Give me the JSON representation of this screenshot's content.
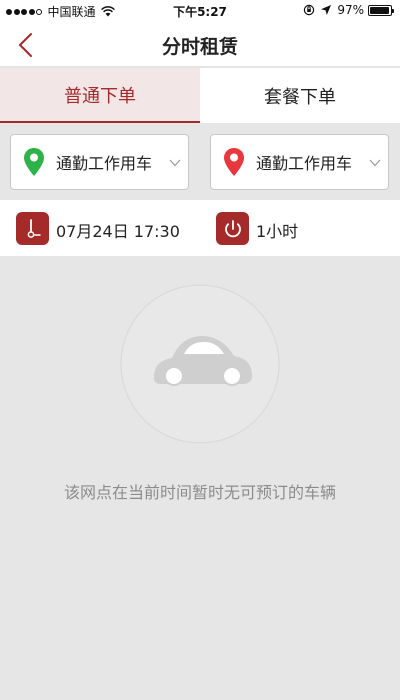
{
  "status_bar": {
    "carrier": "中国联通",
    "time": "下午5:27",
    "battery_percent": "97%",
    "signal_strength": 4,
    "battery_level": 0.97
  },
  "nav": {
    "title": "分时租赁"
  },
  "tabs": [
    {
      "label": "普通下单",
      "active": true
    },
    {
      "label": "套餐下单",
      "active": false
    }
  ],
  "locations": {
    "start": {
      "label": "通勤工作用车",
      "icon": "green-pin-icon",
      "color": "#2db34a"
    },
    "end": {
      "label": "通勤工作用车",
      "icon": "red-pin-icon",
      "color": "#e8383d"
    }
  },
  "schedule": {
    "start_time": "07月24日 17:30",
    "duration": "1小时"
  },
  "empty_state": {
    "icon": "car-icon",
    "message": "该网点在当前时间暂时无可预订的车辆"
  },
  "colors": {
    "accent": "#a52a2a",
    "tab_active_bg": "#f3e6e6",
    "background": "#e6e6e6",
    "muted_text": "#8c8c8c"
  }
}
